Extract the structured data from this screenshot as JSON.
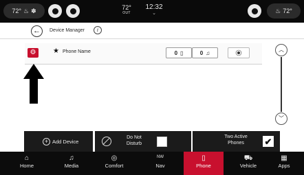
{
  "status_bar": {
    "driver_temp": "72°",
    "passenger_temp": "72°",
    "outside_temp": "72°",
    "outside_label": "OUT",
    "time": "12:32",
    "chevron": "⌄"
  },
  "header": {
    "title": "Device Manager",
    "info_icon": "i",
    "back_icon": "←"
  },
  "device": {
    "name": "Phone Name",
    "star": "★",
    "gear": "⚙",
    "phone_connect": "0",
    "phone_icon": "▯",
    "audio_connect": "0",
    "audio_icon": "♫"
  },
  "scroll": {
    "up": "︿",
    "down": "﹀"
  },
  "actions": {
    "add_device": "Add Device",
    "add_icon": "+",
    "do_not_disturb": "Do Not Disturb",
    "do_not_disturb_checked": false,
    "two_active_phones": "Two Active Phones",
    "two_active_phones_checked": true,
    "check_glyph": "✔"
  },
  "nav": [
    {
      "label": "Home",
      "icon": "home-icon",
      "glyph": "⌂"
    },
    {
      "label": "Media",
      "icon": "music-note-icon",
      "glyph": "♫"
    },
    {
      "label": "Comfort",
      "icon": "comfort-icon",
      "glyph": "◎"
    },
    {
      "label": "Nav",
      "icon": "compass-icon",
      "glyph": "NW"
    },
    {
      "label": "Phone",
      "icon": "phone-icon",
      "glyph": "▯",
      "active": true
    },
    {
      "label": "Vehicle",
      "icon": "car-icon",
      "glyph": "⛟"
    },
    {
      "label": "Apps",
      "icon": "grid-icon",
      "glyph": "▦"
    }
  ],
  "colors": {
    "accent": "#c8102e",
    "bar": "#0c0c0c",
    "strip": "#1b1b1b"
  }
}
